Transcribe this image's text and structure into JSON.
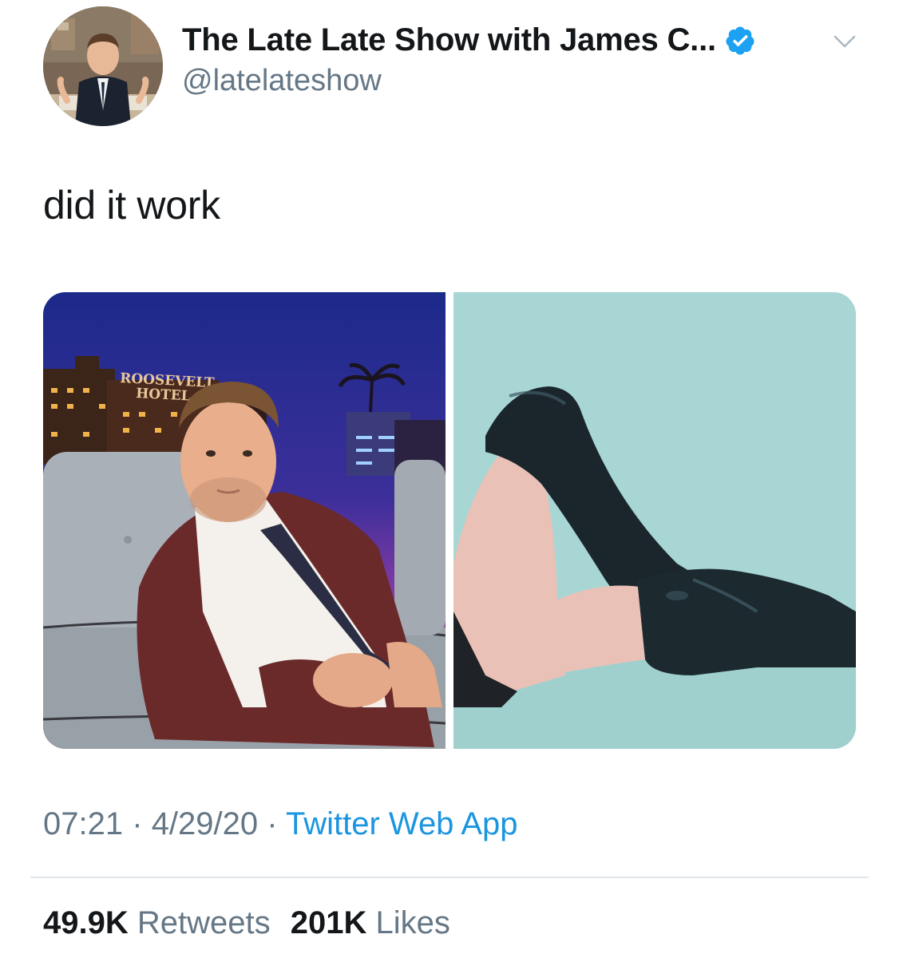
{
  "header": {
    "display_name": "The Late Late Show with James C...",
    "handle": "@latelateshow",
    "verified_icon": "verified-badge-icon",
    "menu_icon": "chevron-down-icon"
  },
  "tweet": {
    "text": "did it work"
  },
  "meta": {
    "time": "07:21",
    "date": "4/29/20",
    "source": "Twitter Web App",
    "separator": "·"
  },
  "stats": {
    "retweets_count": "49.9K",
    "retweets_label": "Retweets",
    "likes_count": "201K",
    "likes_label": "Likes"
  },
  "media": {
    "left_sign_line1": "ROOSEVELT",
    "left_sign_line2": "HOTEL"
  },
  "colors": {
    "accent": "#1b95e0",
    "verified": "#1da1f2",
    "secondary_text": "#657786",
    "primary_text": "#14171a",
    "divider": "#e1e8ed"
  }
}
